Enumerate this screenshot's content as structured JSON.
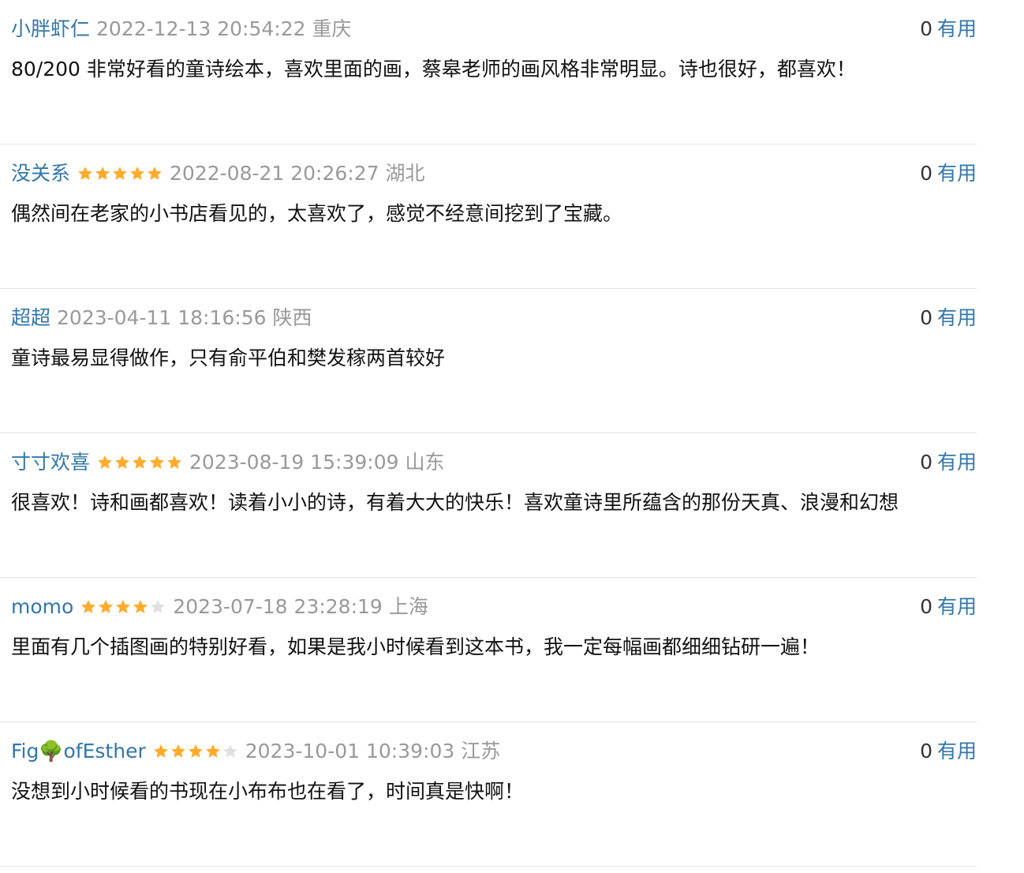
{
  "colors": {
    "link": "#3377aa",
    "meta": "#999999",
    "star_on": "#ffac2d",
    "star_off": "#e0e0e0",
    "divider": "#e5e5e5"
  },
  "comments": [
    {
      "author": "小胖虾仁",
      "rating": null,
      "date": "2022-12-13 20:54:22",
      "location": "重庆",
      "votes": "0",
      "vote_label": "有用",
      "text": "80/200 非常好看的童诗绘本，喜欢里面的画，蔡皋老师的画风格非常明显。诗也很好，都喜欢！"
    },
    {
      "author": "没关系",
      "rating": 5,
      "date": "2022-08-21 20:26:27",
      "location": "湖北",
      "votes": "0",
      "vote_label": "有用",
      "text": "偶然间在老家的小书店看见的，太喜欢了，感觉不经意间挖到了宝藏。"
    },
    {
      "author": "超超",
      "rating": null,
      "date": "2023-04-11 18:16:56",
      "location": "陕西",
      "votes": "0",
      "vote_label": "有用",
      "text": "童诗最易显得做作，只有俞平伯和樊发稼两首较好"
    },
    {
      "author": "寸寸欢喜",
      "rating": 5,
      "date": "2023-08-19 15:39:09",
      "location": "山东",
      "votes": "0",
      "vote_label": "有用",
      "text": "很喜欢！诗和画都喜欢！读着小小的诗，有着大大的快乐！喜欢童诗里所蕴含的那份天真、浪漫和幻想"
    },
    {
      "author": "momo",
      "rating": 4,
      "date": "2023-07-18 23:28:19",
      "location": "上海",
      "votes": "0",
      "vote_label": "有用",
      "text": "里面有几个插图画的特别好看，如果是我小时候看到这本书，我一定每幅画都细细钻研一遍！"
    },
    {
      "author": "Fig🌳ofEsther",
      "rating": 4,
      "date": "2023-10-01 10:39:03",
      "location": "江苏",
      "votes": "0",
      "vote_label": "有用",
      "text": "没想到小时候看的书现在小布布也在看了，时间真是快啊！"
    }
  ]
}
